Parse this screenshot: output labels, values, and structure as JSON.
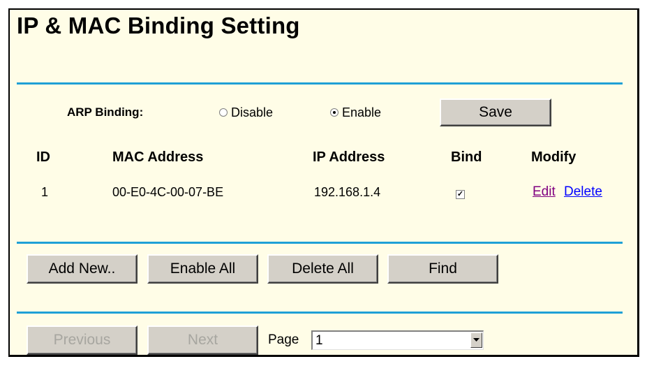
{
  "page": {
    "title": "IP & MAC Binding Setting"
  },
  "arp": {
    "label": "ARP Binding:",
    "options": [
      "Disable",
      "Enable"
    ],
    "selected": "Enable",
    "save_label": "Save"
  },
  "table": {
    "headers": [
      "ID",
      "MAC Address",
      "IP Address",
      "Bind",
      "Modify"
    ],
    "rows": [
      {
        "id": "1",
        "mac": "00-E0-4C-00-07-BE",
        "ip": "192.168.1.4",
        "bind": true,
        "edit": "Edit",
        "delete": "Delete"
      }
    ]
  },
  "actions": {
    "add_new": "Add New..",
    "enable_all": "Enable All",
    "delete_all": "Delete All",
    "find": "Find"
  },
  "pager": {
    "previous": "Previous",
    "next": "Next",
    "page_label": "Page",
    "page_value": "1"
  },
  "colors": {
    "panel_bg": "#fffde7",
    "rule": "#1fa0d6",
    "edit_link": "#800080",
    "delete_link": "#0000ff"
  }
}
